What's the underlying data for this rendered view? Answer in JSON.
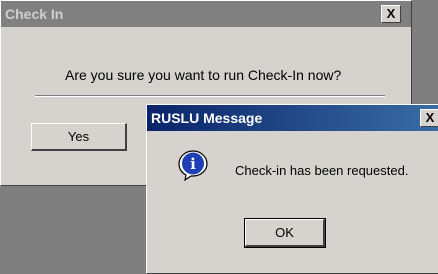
{
  "check_in_dialog": {
    "title": "Check In",
    "close_glyph": "X",
    "question": "Are you sure you want to run Check-In now?",
    "yes_label": "Yes"
  },
  "message_dialog": {
    "title": "RUSLU Message",
    "close_glyph": "X",
    "icon": "info-icon",
    "icon_glyph": "i",
    "message": "Check-in has been requested.",
    "ok_label": "OK"
  }
}
